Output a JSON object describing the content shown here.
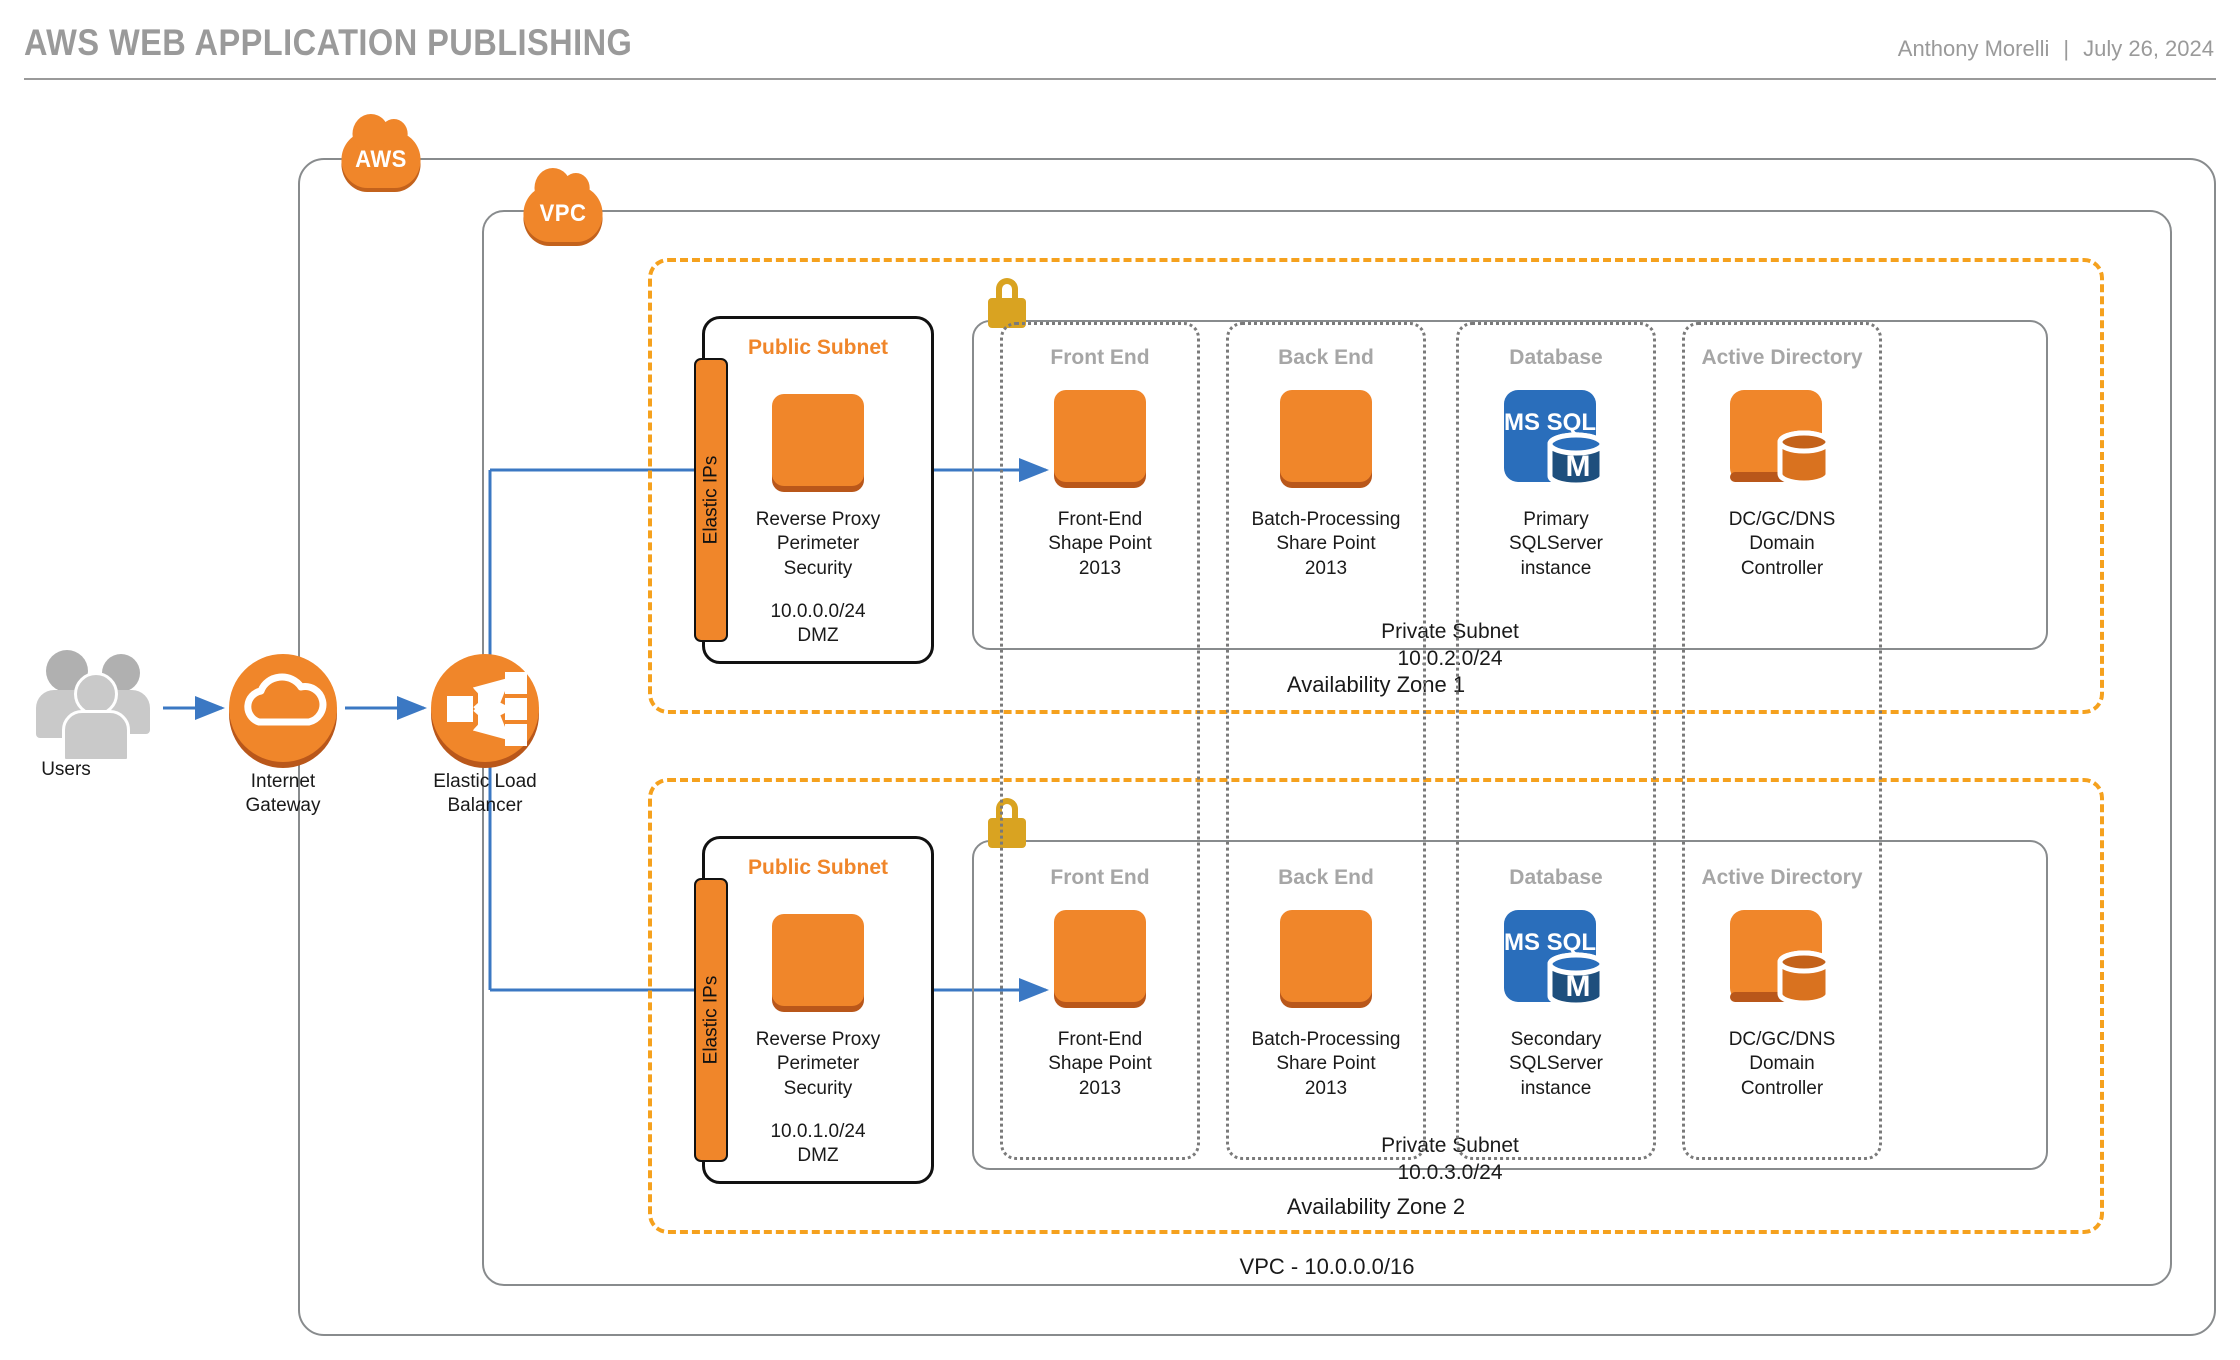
{
  "header": {
    "title": "AWS WEB APPLICATION PUBLISHING",
    "author": "Anthony Morelli",
    "separator": "|",
    "date": "July 26, 2024"
  },
  "colors": {
    "aws_orange": "#f0862a",
    "orange_shadow": "#b9571a",
    "dashed_orange": "#f5a11e",
    "blue_line": "#3b78c3",
    "mssql_blue": "#2a6ebb",
    "lock_gold": "#d9a321",
    "gray_border": "#888b8d",
    "muted_gray": "#a6a6a6"
  },
  "cloud_badges": {
    "aws": "AWS",
    "vpc": "VPC"
  },
  "vpc_caption": "VPC - 10.0.0.0/16",
  "actors": [
    {
      "name": "users",
      "label": "Users",
      "icon": "users-icon"
    },
    {
      "name": "internet-gateway",
      "label": "Internet\nGateway",
      "label_line1": "Internet",
      "label_line2": "Gateway",
      "icon": "cloud-circle-icon"
    },
    {
      "name": "elastic-load-balancer",
      "label_line1": "Elastic Load",
      "label_line2": "Balancer",
      "icon": "load-balancer-icon"
    }
  ],
  "columns": [
    {
      "id": "front-end",
      "title": "Front End"
    },
    {
      "id": "back-end",
      "title": "Back End"
    },
    {
      "id": "database",
      "title": "Database"
    },
    {
      "id": "active-directory",
      "title": "Active Directory"
    }
  ],
  "zones": [
    {
      "id": "az1",
      "label": "Availability Zone 1",
      "public_subnet": {
        "title": "Public Subnet",
        "elastic_ips": "Elastic IPs",
        "node_label_1": "Reverse Proxy",
        "node_label_2": "Perimeter",
        "node_label_3": "Security",
        "cidr": "10.0.0.0/24",
        "cidr_note": "DMZ"
      },
      "private_subnet": {
        "label": "Private Subnet",
        "cidr": "10.0.2.0/24"
      },
      "nodes": [
        {
          "column": "front-end",
          "icon": "orange-tile",
          "line1": "Front-End",
          "line2": "Shape Point",
          "line3": "2013"
        },
        {
          "column": "back-end",
          "icon": "orange-tile",
          "line1": "Batch-Processing",
          "line2": "Share Point",
          "line3": "2013"
        },
        {
          "column": "database",
          "icon": "mssql-icon",
          "icon_text": "MS SQL",
          "icon_badge": "M",
          "line1": "Primary",
          "line2": "SQLServer",
          "line3": "instance"
        },
        {
          "column": "active-directory",
          "icon": "domain-controller-icon",
          "line1": "DC/GC/DNS",
          "line2": "Domain",
          "line3": "Controller"
        }
      ]
    },
    {
      "id": "az2",
      "label": "Availability Zone 2",
      "public_subnet": {
        "title": "Public Subnet",
        "elastic_ips": "Elastic IPs",
        "node_label_1": "Reverse Proxy",
        "node_label_2": "Perimeter",
        "node_label_3": "Security",
        "cidr": "10.0.1.0/24",
        "cidr_note": "DMZ"
      },
      "private_subnet": {
        "label": "Private Subnet",
        "cidr": "10.0.3.0/24"
      },
      "nodes": [
        {
          "column": "front-end",
          "icon": "orange-tile",
          "line1": "Front-End",
          "line2": "Shape Point",
          "line3": "2013"
        },
        {
          "column": "back-end",
          "icon": "orange-tile",
          "line1": "Batch-Processing",
          "line2": "Share Point",
          "line3": "2013"
        },
        {
          "column": "database",
          "icon": "mssql-icon",
          "icon_text": "MS SQL",
          "icon_badge": "M",
          "line1": "Secondary",
          "line2": "SQLServer",
          "line3": "instance"
        },
        {
          "column": "active-directory",
          "icon": "domain-controller-icon",
          "line1": "DC/GC/DNS",
          "line2": "Domain",
          "line3": "Controller"
        }
      ]
    }
  ]
}
